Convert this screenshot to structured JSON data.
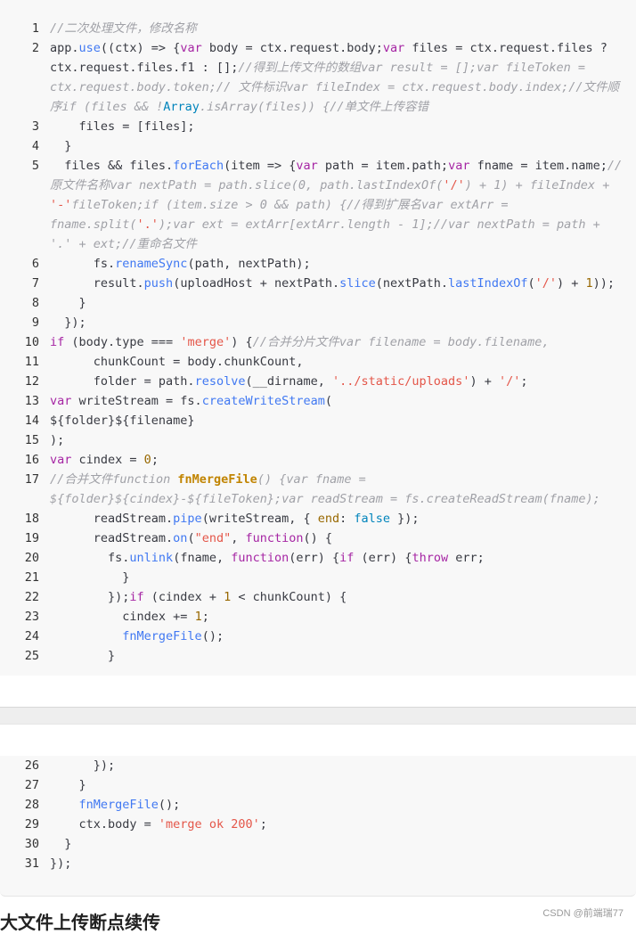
{
  "code_block_1": {
    "lines": [
      {
        "n": "1",
        "t": [
          [
            "c",
            "//二次处理文件，修改名称"
          ]
        ]
      },
      {
        "n": "2",
        "t": [
          [
            "p",
            "app."
          ],
          [
            "f",
            "use"
          ],
          [
            "p",
            "((ctx) => {"
          ],
          [
            "k",
            "var"
          ],
          [
            "p",
            " body = ctx.request.body;"
          ],
          [
            "k",
            "var"
          ],
          [
            "p",
            " files = ctx.request.files ?"
          ]
        ]
      },
      {
        "n": "",
        "t": [
          [
            "p",
            "ctx.request.files.f1 : [];"
          ],
          [
            "c",
            "//得到上传文件的数组var result = [];var fileToken ="
          ]
        ]
      },
      {
        "n": "",
        "t": [
          [
            "c",
            "ctx.request.body.token;// 文件标识var fileIndex = ctx.request.body.index;//文件顺"
          ]
        ]
      },
      {
        "n": "",
        "t": [
          [
            "c",
            "序if (files && !"
          ],
          [
            "b",
            "Array"
          ],
          [
            "c",
            ".isArray(files)) {//单文件上传容错"
          ]
        ]
      },
      {
        "n": "3",
        "t": [
          [
            "p",
            "    files = [files];"
          ]
        ]
      },
      {
        "n": "4",
        "t": [
          [
            "p",
            "  }"
          ]
        ]
      },
      {
        "n": "5",
        "t": [
          [
            "p",
            "  files && files."
          ],
          [
            "f",
            "forEach"
          ],
          [
            "p",
            "(item => {"
          ],
          [
            "k",
            "var"
          ],
          [
            "p",
            " path = item.path;"
          ],
          [
            "k",
            "var"
          ],
          [
            "p",
            " fname = item.name;"
          ],
          [
            "c",
            "//"
          ]
        ]
      },
      {
        "n": "",
        "t": [
          [
            "c",
            "原文件名称var nextPath = path.slice(0, path.lastIndexOf("
          ],
          [
            "s",
            "'/'"
          ],
          [
            "c",
            ") + 1) + fileIndex +"
          ]
        ]
      },
      {
        "n": "",
        "t": [
          [
            "s",
            "'-'"
          ],
          [
            "c",
            "fileToken;if (item.size > 0 && path) {//得到扩展名var extArr ="
          ]
        ]
      },
      {
        "n": "",
        "t": [
          [
            "c",
            "fname.split("
          ],
          [
            "s",
            "'.'"
          ],
          [
            "c",
            ");var ext = extArr[extArr.length - 1];//var nextPath = path +"
          ]
        ]
      },
      {
        "n": "",
        "t": [
          [
            "c",
            "'.' + ext;//重命名文件"
          ]
        ]
      },
      {
        "n": "6",
        "t": [
          [
            "p",
            "      fs."
          ],
          [
            "f",
            "renameSync"
          ],
          [
            "p",
            "(path, nextPath);"
          ]
        ]
      },
      {
        "n": "7",
        "t": [
          [
            "p",
            "      result."
          ],
          [
            "f",
            "push"
          ],
          [
            "p",
            "(uploadHost + nextPath."
          ],
          [
            "f",
            "slice"
          ],
          [
            "p",
            "(nextPath."
          ],
          [
            "f",
            "lastIndexOf"
          ],
          [
            "p",
            "("
          ],
          [
            "s",
            "'/'"
          ],
          [
            "p",
            ") + "
          ],
          [
            "n",
            "1"
          ],
          [
            "p",
            "));"
          ]
        ]
      },
      {
        "n": "8",
        "t": [
          [
            "p",
            "    }"
          ]
        ]
      },
      {
        "n": "9",
        "t": [
          [
            "p",
            "  });"
          ]
        ]
      },
      {
        "n": "10",
        "t": [
          [
            "k",
            "if"
          ],
          [
            "p",
            " (body.type === "
          ],
          [
            "s",
            "'merge'"
          ],
          [
            "p",
            ") {"
          ],
          [
            "c",
            "//合并分片文件var filename = body.filename,"
          ]
        ]
      },
      {
        "n": "11",
        "t": [
          [
            "p",
            "      chunkCount = body.chunkCount,"
          ]
        ]
      },
      {
        "n": "12",
        "t": [
          [
            "p",
            "      folder = path."
          ],
          [
            "f",
            "resolve"
          ],
          [
            "p",
            "(__dirname, "
          ],
          [
            "s",
            "'../static/uploads'"
          ],
          [
            "p",
            ") + "
          ],
          [
            "s",
            "'/'"
          ],
          [
            "p",
            ";"
          ]
        ]
      },
      {
        "n": "13",
        "t": [
          [
            "k",
            "var"
          ],
          [
            "p",
            " writeStream = fs."
          ],
          [
            "f",
            "createWriteStream"
          ],
          [
            "p",
            "("
          ]
        ]
      },
      {
        "n": "14",
        "t": [
          [
            "p",
            "${folder}${filename}"
          ]
        ]
      },
      {
        "n": "15",
        "t": [
          [
            "p",
            ");"
          ]
        ]
      },
      {
        "n": "16",
        "t": [
          [
            "k",
            "var"
          ],
          [
            "p",
            " cindex = "
          ],
          [
            "n",
            "0"
          ],
          [
            "p",
            ";"
          ]
        ]
      },
      {
        "n": "17",
        "t": [
          [
            "c",
            "//合并文件function "
          ],
          [
            "fb",
            "fnMergeFile"
          ],
          [
            "c",
            "() {var fname ="
          ]
        ]
      },
      {
        "n": "",
        "t": [
          [
            "c",
            "${folder}${cindex}-${fileToken};var readStream = fs.createReadStream(fname);"
          ]
        ]
      },
      {
        "n": "18",
        "t": [
          [
            "p",
            "      readStream."
          ],
          [
            "f",
            "pipe"
          ],
          [
            "p",
            "(writeStream, { "
          ],
          [
            "n",
            "end"
          ],
          [
            "p",
            ": "
          ],
          [
            "b",
            "false"
          ],
          [
            "p",
            " });"
          ]
        ]
      },
      {
        "n": "19",
        "t": [
          [
            "p",
            "      readStream."
          ],
          [
            "f",
            "on"
          ],
          [
            "p",
            "("
          ],
          [
            "s",
            "\"end\""
          ],
          [
            "p",
            ", "
          ],
          [
            "k",
            "function"
          ],
          [
            "p",
            "() {"
          ]
        ]
      },
      {
        "n": "20",
        "t": [
          [
            "p",
            "        fs."
          ],
          [
            "f",
            "unlink"
          ],
          [
            "p",
            "(fname, "
          ],
          [
            "k",
            "function"
          ],
          [
            "p",
            "(err) {"
          ],
          [
            "k",
            "if"
          ],
          [
            "p",
            " (err) {"
          ],
          [
            "k",
            "throw"
          ],
          [
            "p",
            " err;"
          ]
        ]
      },
      {
        "n": "21",
        "t": [
          [
            "p",
            "          }"
          ]
        ]
      },
      {
        "n": "22",
        "t": [
          [
            "p",
            "        });"
          ],
          [
            "k",
            "if"
          ],
          [
            "p",
            " (cindex + "
          ],
          [
            "n",
            "1"
          ],
          [
            "p",
            " < chunkCount) {"
          ]
        ]
      },
      {
        "n": "23",
        "t": [
          [
            "p",
            "          cindex += "
          ],
          [
            "n",
            "1"
          ],
          [
            "p",
            ";"
          ]
        ]
      },
      {
        "n": "24",
        "t": [
          [
            "p",
            "          "
          ],
          [
            "f",
            "fnMergeFile"
          ],
          [
            "p",
            "();"
          ]
        ]
      },
      {
        "n": "25",
        "t": [
          [
            "p",
            "        }"
          ]
        ]
      }
    ]
  },
  "code_block_2": {
    "lines": [
      {
        "n": "26",
        "t": [
          [
            "p",
            "      });"
          ]
        ]
      },
      {
        "n": "27",
        "t": [
          [
            "p",
            "    }"
          ]
        ]
      },
      {
        "n": "28",
        "t": [
          [
            "p",
            "    "
          ],
          [
            "f",
            "fnMergeFile"
          ],
          [
            "p",
            "();"
          ]
        ]
      },
      {
        "n": "29",
        "t": [
          [
            "p",
            "    ctx.body = "
          ],
          [
            "s",
            "'merge ok 200'"
          ],
          [
            "p",
            ";"
          ]
        ]
      },
      {
        "n": "30",
        "t": [
          [
            "p",
            "  }"
          ]
        ]
      },
      {
        "n": "31",
        "t": [
          [
            "p",
            "});"
          ]
        ]
      }
    ]
  },
  "footer": {
    "heading": "大文件上传断点续传",
    "watermark": "CSDN @前端瑞77"
  }
}
